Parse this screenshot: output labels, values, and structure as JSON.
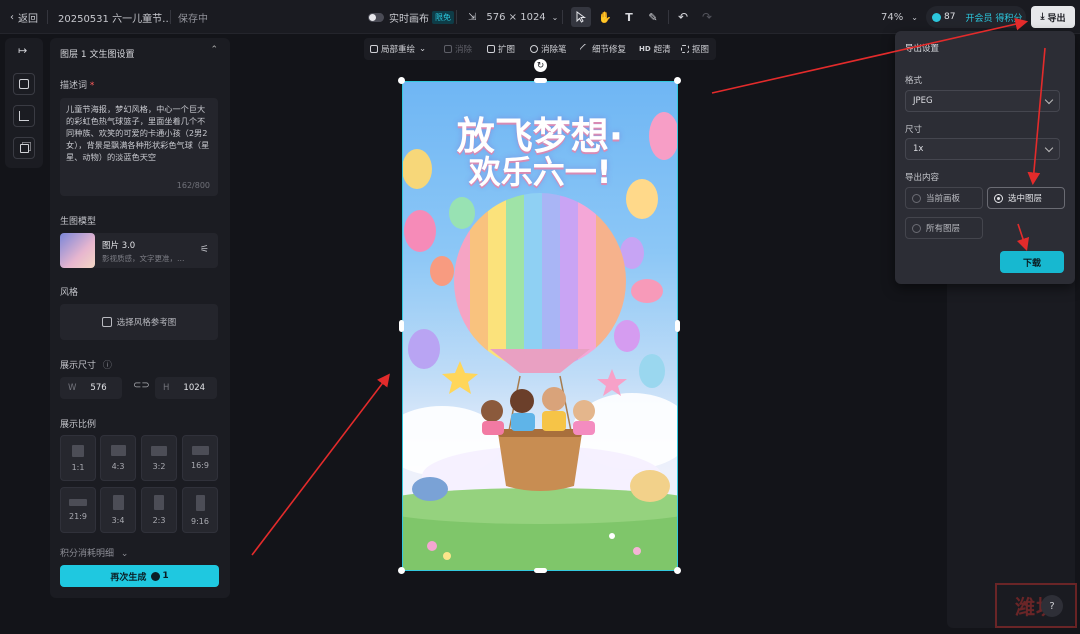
{
  "header": {
    "back_label": "返回",
    "project_title": "20250531 六一儿童节…",
    "save_status": "保存中",
    "realtime_label": "实时画布",
    "realtime_badge": "限免",
    "canvas_size": "576 × 1024",
    "zoom": "74%",
    "credits": "87",
    "member_label": "开会员 得积分",
    "export_label": "导出"
  },
  "panel": {
    "title": "图层 1 文生图设置",
    "prompt_label": "描述词",
    "prompt_required": "*",
    "prompt_text": "儿童节海报，梦幻风格，中心一个巨大的彩虹色热气球篮子，里面坐着几个不同种族、欢笑的可爱的卡通小孩（2男2女），背景是飘满各种形状彩色气球（星星、动物）的淡蓝色天空",
    "prompt_count": "162/800",
    "model_label": "生图模型",
    "model_name": "图片 3.0",
    "model_desc": "影视质感，文字更准，…",
    "style_label": "风格",
    "style_placeholder": "选择风格参考图",
    "size_label": "展示尺寸",
    "width_label": "W",
    "width_value": "576",
    "height_label": "H",
    "height_value": "1024",
    "ratio_label": "展示比例",
    "ratios": [
      "1:1",
      "4:3",
      "3:2",
      "16:9",
      "21:9",
      "3:4",
      "2:3",
      "9:16"
    ],
    "credit_detail_label": "积分消耗明细",
    "regenerate_label": "再次生成",
    "regenerate_cost": "1"
  },
  "canvas_toolbar": {
    "items": [
      "局部重绘",
      "消除",
      "扩图",
      "消除笔",
      "细节修复",
      "超清",
      "抠图"
    ],
    "hd_prefix": "HD"
  },
  "poster": {
    "line1": "放飞梦想·",
    "line2": "欢乐六一!"
  },
  "export_panel": {
    "title": "导出设置",
    "format_label": "格式",
    "format_value": "JPEG",
    "size_label": "尺寸",
    "size_value": "1x",
    "content_label": "导出内容",
    "options": [
      "当前画板",
      "选中图层",
      "所有图层"
    ],
    "download_label": "下载"
  },
  "help_label": "?",
  "watermark_text": "潍坊"
}
